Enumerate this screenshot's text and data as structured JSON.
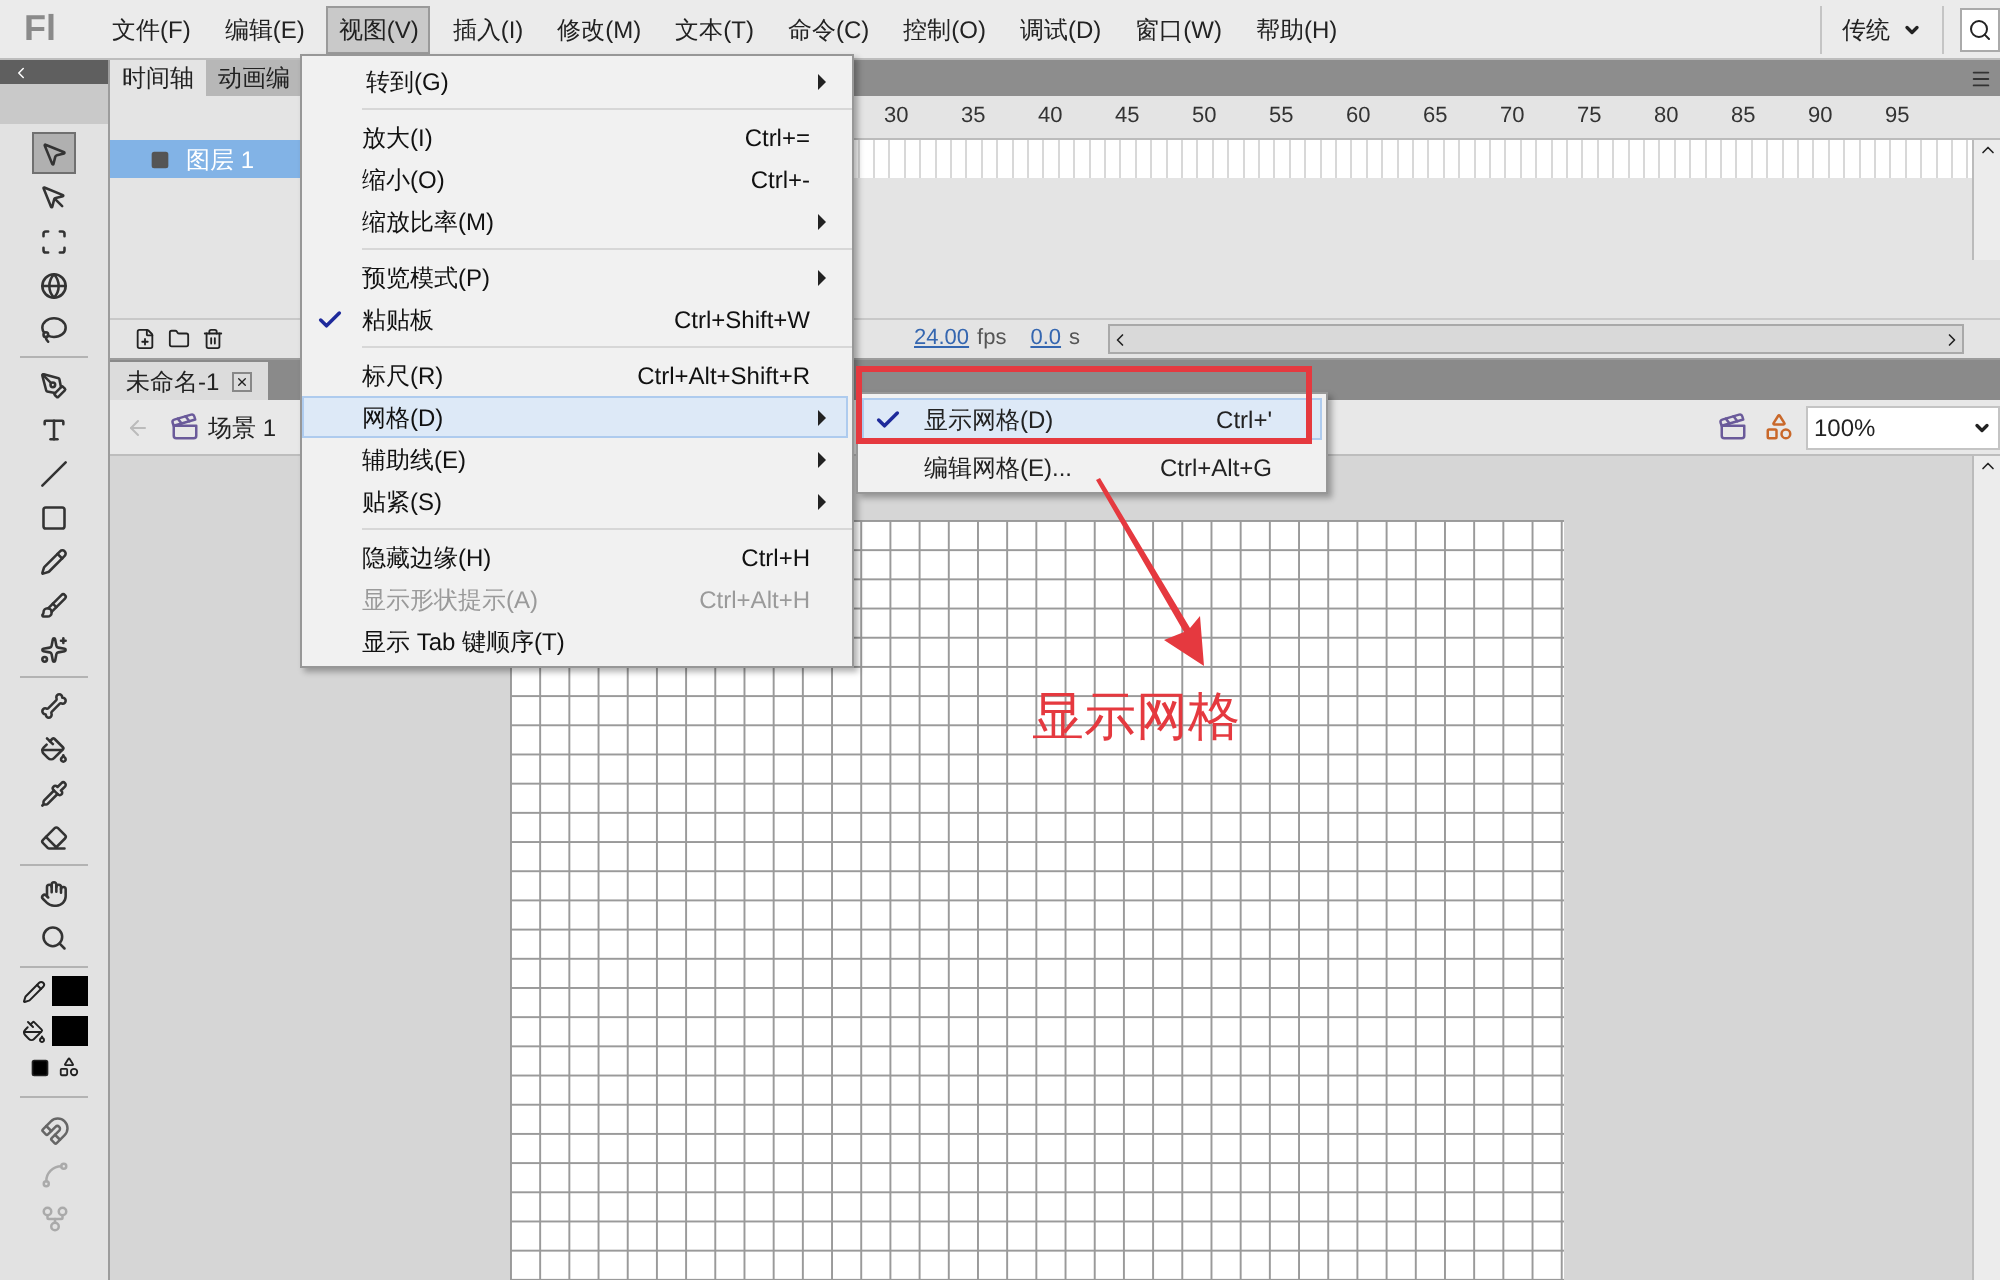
{
  "app_logo": "Fl",
  "menu_bar": [
    {
      "label": "文件(F)",
      "selected": false
    },
    {
      "label": "编辑(E)",
      "selected": false
    },
    {
      "label": "视图(V)",
      "selected": true
    },
    {
      "label": "插入(I)",
      "selected": false
    },
    {
      "label": "修改(M)",
      "selected": false
    },
    {
      "label": "文本(T)",
      "selected": false
    },
    {
      "label": "命令(C)",
      "selected": false
    },
    {
      "label": "控制(O)",
      "selected": false
    },
    {
      "label": "调试(D)",
      "selected": false
    },
    {
      "label": "窗口(W)",
      "selected": false
    },
    {
      "label": "帮助(H)",
      "selected": false
    }
  ],
  "workspace": {
    "label": "传统"
  },
  "tools": [
    {
      "kind": "selection",
      "selected": true
    },
    {
      "kind": "subselection",
      "selected": false
    },
    {
      "kind": "transform",
      "selected": false
    },
    {
      "kind": "rotate3d",
      "selected": false
    },
    {
      "kind": "lasso",
      "selected": false
    },
    {
      "kind": "sep",
      "selected": false
    },
    {
      "kind": "pen",
      "selected": false
    },
    {
      "kind": "text",
      "selected": false
    },
    {
      "kind": "line",
      "selected": false
    },
    {
      "kind": "rectangle",
      "selected": false
    },
    {
      "kind": "pencil",
      "selected": false
    },
    {
      "kind": "brush",
      "selected": false
    },
    {
      "kind": "deco",
      "selected": false
    },
    {
      "kind": "sep",
      "selected": false
    },
    {
      "kind": "bone",
      "selected": false
    },
    {
      "kind": "bucket",
      "selected": false
    },
    {
      "kind": "eyedropper",
      "selected": false
    },
    {
      "kind": "eraser",
      "selected": false
    },
    {
      "kind": "sep",
      "selected": false
    },
    {
      "kind": "hand",
      "selected": false
    },
    {
      "kind": "zoom",
      "selected": false
    }
  ],
  "timeline": {
    "tabs": [
      {
        "label": "时间轴",
        "selected": true
      },
      {
        "label": "动画编",
        "selected": false
      }
    ],
    "layers": [
      {
        "name": "图层 1",
        "selected": true
      }
    ],
    "frame_numbers": [
      "30",
      "35",
      "40",
      "45",
      "50",
      "55",
      "60",
      "65",
      "70",
      "75",
      "80",
      "85",
      "90",
      "95"
    ],
    "fps": "24.00",
    "fps_unit": "fps",
    "time": "0.0",
    "time_unit": "s"
  },
  "document_tabs": [
    {
      "label": "未命名-1",
      "selected": true
    }
  ],
  "edit_bar": {
    "scene": "场景 1",
    "zoom": "100%"
  },
  "view_menu": [
    [
      {
        "label": "转到(G)",
        "submenu": true,
        "checked": false,
        "disabled": false,
        "selected": false
      }
    ],
    [
      {
        "label": "放大(I)",
        "shortcut": "Ctrl+=",
        "submenu": false,
        "checked": false,
        "disabled": false,
        "selected": false
      },
      {
        "label": "缩小(O)",
        "shortcut": "Ctrl+-",
        "submenu": false,
        "checked": false,
        "disabled": false,
        "selected": false
      },
      {
        "label": "缩放比率(M)",
        "submenu": true,
        "checked": false,
        "disabled": false,
        "selected": false
      }
    ],
    [
      {
        "label": "预览模式(P)",
        "submenu": true,
        "checked": false,
        "disabled": false,
        "selected": false
      },
      {
        "label": "粘贴板",
        "shortcut": "Ctrl+Shift+W",
        "submenu": false,
        "checked": true,
        "disabled": false,
        "selected": false
      }
    ],
    [
      {
        "label": "标尺(R)",
        "shortcut": "Ctrl+Alt+Shift+R",
        "submenu": false,
        "checked": false,
        "disabled": false,
        "selected": false
      },
      {
        "label": "网格(D)",
        "submenu": true,
        "checked": false,
        "disabled": false,
        "selected": true
      },
      {
        "label": "辅助线(E)",
        "submenu": true,
        "checked": false,
        "disabled": false,
        "selected": false
      },
      {
        "label": "贴紧(S)",
        "submenu": true,
        "checked": false,
        "disabled": false,
        "selected": false
      }
    ],
    [
      {
        "label": "隐藏边缘(H)",
        "shortcut": "Ctrl+H",
        "submenu": false,
        "checked": false,
        "disabled": false,
        "selected": false
      },
      {
        "label": "显示形状提示(A)",
        "shortcut": "Ctrl+Alt+H",
        "submenu": false,
        "checked": false,
        "disabled": true,
        "selected": false
      },
      {
        "label": "显示 Tab 键顺序(T)",
        "submenu": false,
        "checked": false,
        "disabled": false,
        "selected": false
      }
    ]
  ],
  "grid_submenu": [
    {
      "label": "显示网格(D)",
      "shortcut": "Ctrl+'",
      "checked": true,
      "selected": true
    },
    {
      "label": "编辑网格(E)...",
      "shortcut": "Ctrl+Alt+G",
      "checked": false,
      "selected": false
    }
  ],
  "annotation": {
    "text": "显示网格"
  }
}
